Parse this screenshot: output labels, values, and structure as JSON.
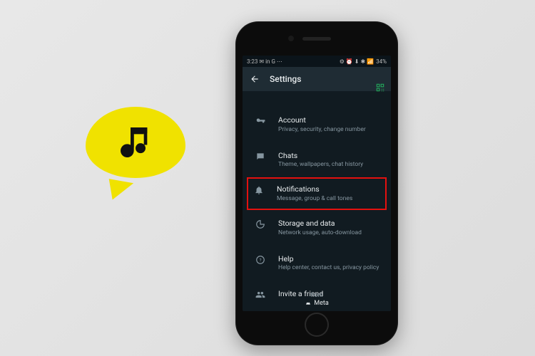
{
  "statusbar": {
    "time": "3:23",
    "left_icons": "✉ in G ⋯",
    "right_icons": "⚙ ⏰ ⬇ ✱ 📶",
    "battery": "34%"
  },
  "header": {
    "title": "Settings"
  },
  "items": [
    {
      "title": "Account",
      "sub": "Privacy, security, change number"
    },
    {
      "title": "Chats",
      "sub": "Theme, wallpapers, chat history"
    },
    {
      "title": "Notifications",
      "sub": "Message, group & call tones"
    },
    {
      "title": "Storage and data",
      "sub": "Network usage, auto-download"
    },
    {
      "title": "Help",
      "sub": "Help center, contact us, privacy policy"
    },
    {
      "title": "Invite a friend",
      "sub": ""
    }
  ],
  "footer": {
    "from": "from",
    "brand": "Meta"
  }
}
